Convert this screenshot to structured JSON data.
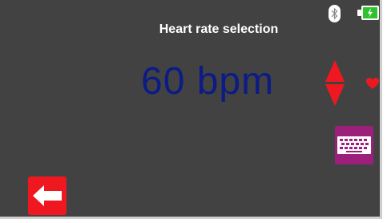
{
  "screen": {
    "title": "Heart rate selection",
    "value": "60 bpm"
  },
  "status_bar": {
    "bluetooth_icon": "bluetooth-icon",
    "battery_icon": "battery-charging-icon"
  },
  "controls": {
    "adjust_icon": "up-down-arrows-icon",
    "heart_icon": "heart-icon",
    "keyboard_icon": "keyboard-icon",
    "back_icon": "back-arrow-icon"
  },
  "colors": {
    "background": "#424242",
    "value_text": "#0c1b86",
    "accent_red": "#f01820",
    "keyboard_button": "#9c1f7c",
    "battery": "#2ec32e"
  }
}
